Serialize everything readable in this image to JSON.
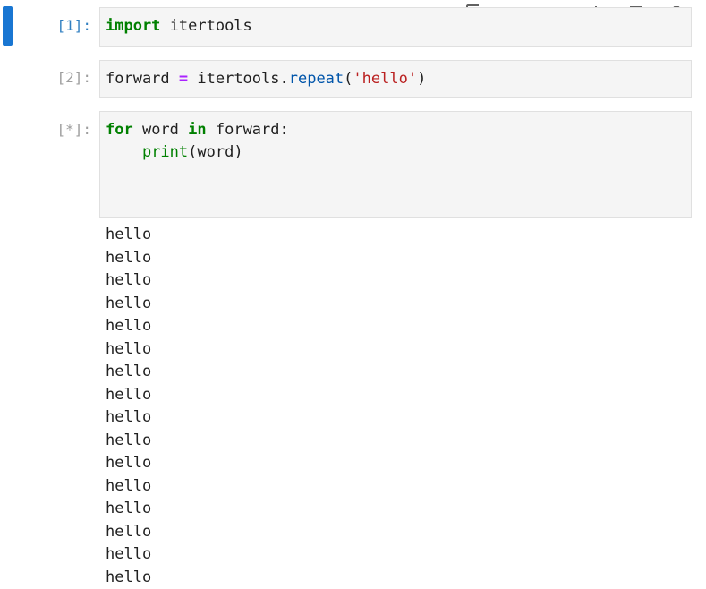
{
  "toolbar": {
    "buttons": [
      {
        "icon": "duplicate-icon"
      },
      {
        "icon": "arrow-up-icon"
      },
      {
        "icon": "arrow-down-icon"
      },
      {
        "icon": "insert-above-icon"
      },
      {
        "icon": "insert-below-icon"
      },
      {
        "icon": "delete-icon"
      }
    ]
  },
  "cells": [
    {
      "prompt": "[1]:",
      "code": {
        "kw_import": "import",
        "module": " itertools"
      }
    },
    {
      "prompt": "[2]:",
      "code": {
        "var": "forward ",
        "op": "=",
        "obj": " itertools.",
        "fn": "repeat",
        "open": "(",
        "str": "'hello'",
        "close": ")"
      }
    },
    {
      "prompt": "[*]:",
      "code": {
        "kw_for": "for",
        "mid": " word ",
        "kw_in": "in",
        "end": " forward:",
        "indent": "    ",
        "fn_print": "print",
        "args": "(word)"
      }
    }
  ],
  "output": {
    "lines": [
      "hello",
      "hello",
      "hello",
      "hello",
      "hello",
      "hello",
      "hello",
      "hello",
      "hello",
      "hello",
      "hello",
      "hello",
      "hello",
      "hello",
      "hello",
      "hello"
    ]
  },
  "colors": {
    "active_indicator": "#1976d2",
    "prompt_active": "#307fc1",
    "prompt_inactive": "#9e9e9e",
    "keyword": "#008000",
    "operator": "#aa22ff",
    "function": "#0055aa",
    "string": "#ba2121",
    "cell_bg": "#f5f5f5"
  }
}
